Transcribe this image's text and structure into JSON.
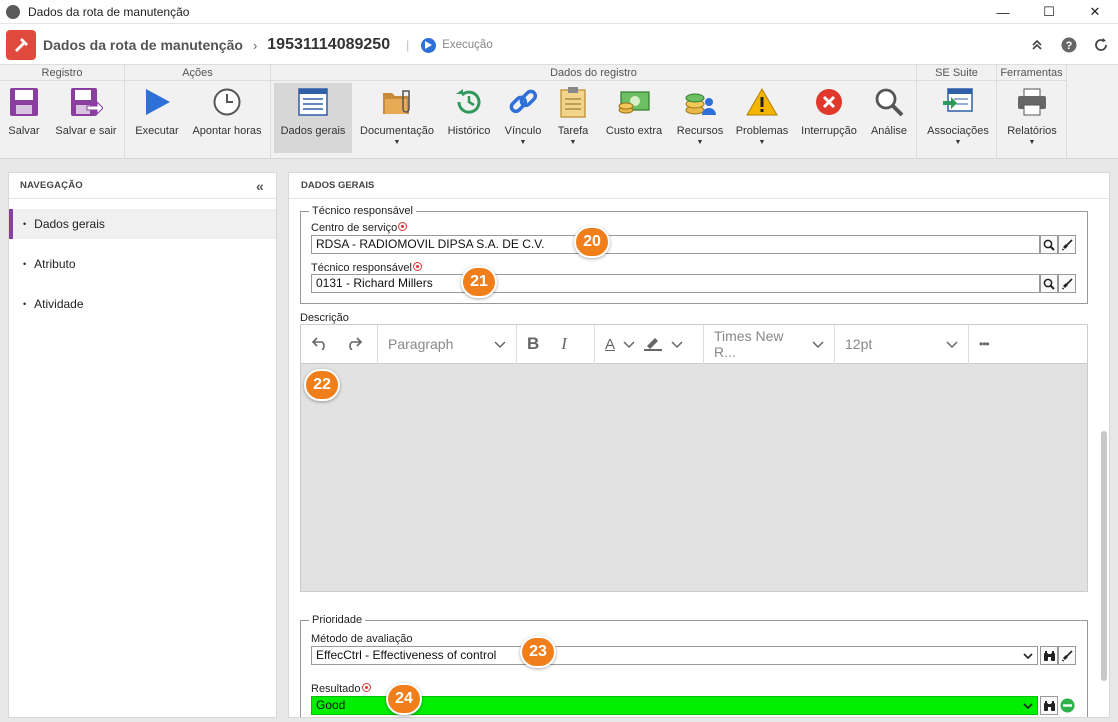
{
  "window": {
    "title": "Dados da rota de manutenção",
    "minimize": "—",
    "maximize": "☐",
    "close": "✕"
  },
  "header": {
    "title": "Dados da rota de manutenção",
    "separator": "›",
    "record_number": "19531114089250",
    "divider": "|",
    "status": "Execução"
  },
  "ribbon": {
    "groups": {
      "registro": "Registro",
      "acoes": "Ações",
      "dados_registro": "Dados do registro",
      "se_suite": "SE Suite",
      "ferramentas": "Ferramentas"
    },
    "buttons": {
      "salvar": "Salvar",
      "salvar_sair": "Salvar e sair",
      "executar": "Executar",
      "apontar_horas": "Apontar horas",
      "dados_gerais": "Dados gerais",
      "documentacao": "Documentação",
      "historico": "Histórico",
      "vinculo": "Vínculo",
      "tarefa": "Tarefa",
      "custo_extra": "Custo extra",
      "recursos": "Recursos",
      "problemas": "Problemas",
      "interrupcao": "Interrupção",
      "analise": "Análise",
      "associacoes": "Associações",
      "relatorios": "Relatórios"
    }
  },
  "nav": {
    "title": "NAVEGAÇÃO",
    "collapse": "«",
    "items": [
      "Dados gerais",
      "Atributo",
      "Atividade"
    ]
  },
  "main": {
    "title": "DADOS GERAIS",
    "tecnico_group": "Técnico responsável",
    "centro_label": "Centro de serviço",
    "centro_value": "RDSA - RADIOMOVIL DIPSA S.A. DE C.V.",
    "tecnico_label": "Técnico responsável",
    "tecnico_value": "0131 - Richard Millers",
    "descricao_label": "Descrição",
    "editor": {
      "block_format": "Paragraph",
      "font_family": "Times New R...",
      "font_size": "12pt",
      "more": "•••",
      "bold": "B",
      "italic": "I",
      "text_color": "A"
    },
    "prioridade_group": "Prioridade",
    "metodo_label": "Método de avaliação",
    "metodo_value": "EffecCtrl - Effectiveness of control",
    "resultado_label": "Resultado",
    "resultado_value": "Good",
    "resultado_color": "#00ee00"
  },
  "callouts": [
    "20",
    "21",
    "22",
    "23",
    "24"
  ],
  "colors": {
    "accent": "#8a3fa0",
    "badge": "#f07f1b",
    "logo": "#e04a3c",
    "status_dot": "#2e6fd8"
  }
}
